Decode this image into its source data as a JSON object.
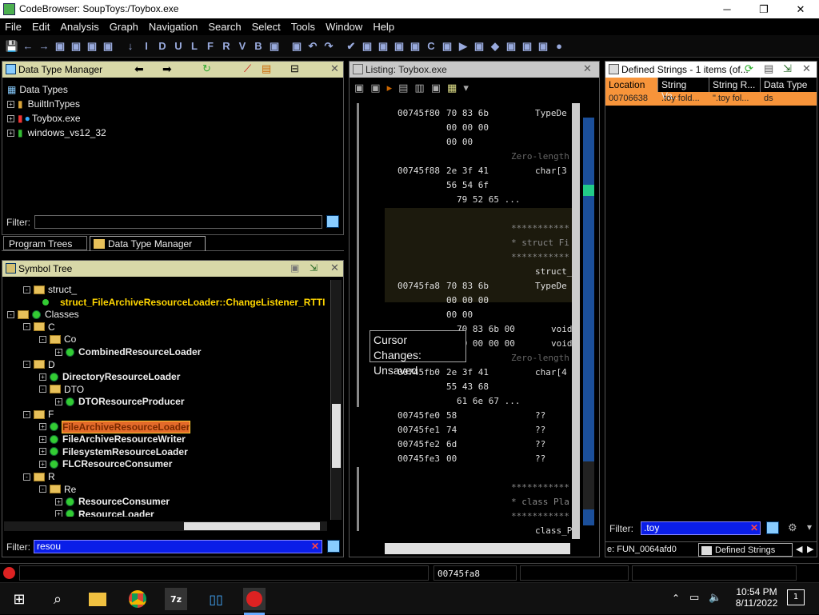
{
  "window": {
    "title": "CodeBrowser: SoupToys:/Toybox.exe",
    "min": "─",
    "max": "❐",
    "close": "✕"
  },
  "menu": [
    "File",
    "Edit",
    "Analysis",
    "Graph",
    "Navigation",
    "Search",
    "Select",
    "Tools",
    "Window",
    "Help"
  ],
  "toolbar_glyphs": [
    "💾",
    "←",
    "→",
    "▣",
    "▣",
    "▣",
    "▣",
    "↓",
    "I",
    "D",
    "U",
    "L",
    "F",
    "R",
    "V",
    "B",
    "▣",
    "▣",
    "↶",
    "↷",
    "✔",
    "▣",
    "▣",
    "▣",
    "▣",
    "C",
    "▣",
    "▶",
    "▣",
    "◆",
    "▣",
    "▣",
    "▣",
    "●"
  ],
  "dtm": {
    "title": "Data Type Manager",
    "root": "Data Types",
    "items": [
      "BuiltInTypes",
      "Toybox.exe",
      "windows_vs12_32"
    ],
    "filter_label": "Filter:",
    "filter_value": ""
  },
  "tabs": {
    "program_trees": "Program Trees",
    "dtm": "Data Type Manager"
  },
  "symtree": {
    "title": "Symbol Tree",
    "rows": [
      {
        "text": "struct_",
        "kind": "folder",
        "indent": 1
      },
      {
        "text": "struct_FileArchiveResourceLoader::ChangeListener_RTTI",
        "kind": "leaf",
        "indent": 2
      },
      {
        "text": "Classes",
        "kind": "classes",
        "indent": 0
      },
      {
        "text": "C",
        "kind": "folder",
        "indent": 1
      },
      {
        "text": "Co",
        "kind": "folder",
        "indent": 2
      },
      {
        "text": "CombinedResourceLoader",
        "kind": "class",
        "indent": 3
      },
      {
        "text": "D",
        "kind": "folder",
        "indent": 1
      },
      {
        "text": "DirectoryResourceLoader",
        "kind": "class",
        "indent": 2
      },
      {
        "text": "DTO",
        "kind": "folder",
        "indent": 2
      },
      {
        "text": "DTOResourceProducer",
        "kind": "class",
        "indent": 3
      },
      {
        "text": "F",
        "kind": "folder",
        "indent": 1
      },
      {
        "text": "FileArchiveResourceLoader",
        "kind": "selected",
        "indent": 2
      },
      {
        "text": "FileArchiveResourceWriter",
        "kind": "class",
        "indent": 2
      },
      {
        "text": "FilesystemResourceLoader",
        "kind": "class",
        "indent": 2
      },
      {
        "text": "FLCResourceConsumer",
        "kind": "class",
        "indent": 2
      },
      {
        "text": "R",
        "kind": "folder",
        "indent": 1
      },
      {
        "text": "Re",
        "kind": "folder",
        "indent": 2
      },
      {
        "text": "ResourceConsumer",
        "kind": "class",
        "indent": 3
      },
      {
        "text": "ResourceLoader",
        "kind": "class",
        "indent": 3
      },
      {
        "text": "ResourceLoaderException",
        "kind": "class",
        "indent": 3
      }
    ],
    "filter_label": "Filter:",
    "filter_value": "resou"
  },
  "listing": {
    "title": "Listing:  Toybox.exe",
    "lines": [
      {
        "a": "00745f80",
        "h": "70 83 6b",
        "m": "TypeDe"
      },
      {
        "a": "",
        "h": "00 00 00",
        "m": ""
      },
      {
        "a": "",
        "h": "00 00",
        "m": ""
      },
      {
        "a": "",
        "h": "",
        "m": "",
        "c": "Zero-length"
      },
      {
        "a": "00745f88",
        "h": "2e 3f 41",
        "m": "char[3"
      },
      {
        "a": "",
        "h": "56 54 6f",
        "m": ""
      },
      {
        "a": "",
        "h": "79 52 65 ...",
        "m": ""
      },
      {
        "a": "",
        "h": "",
        "m": ""
      },
      {
        "a": "",
        "h": "",
        "m": "",
        "s": "***********"
      },
      {
        "a": "",
        "h": "",
        "m": "",
        "s": "* struct Fi"
      },
      {
        "a": "",
        "h": "",
        "m": "",
        "s": "***********"
      },
      {
        "a": "",
        "h": "",
        "m": "struct_File"
      },
      {
        "a": "00745fa8",
        "h": "70 83 6b",
        "m": "TypeDe"
      },
      {
        "a": "",
        "h": "00 00 00",
        "m": ""
      },
      {
        "a": "",
        "h": "00 00",
        "m": ""
      },
      {
        "a": "",
        "h": "70 83 6b 00",
        "m": "void"
      },
      {
        "a": "",
        "h": "00 00 00 00",
        "m": "void"
      },
      {
        "a": "",
        "h": "",
        "m": "",
        "c": "Zero-length"
      },
      {
        "a": "00745fb0",
        "h": "2e 3f 41",
        "m": "char[4"
      },
      {
        "a": "",
        "h": "55 43 68",
        "m": ""
      },
      {
        "a": "",
        "h": "61 6e 67 ...",
        "m": ""
      },
      {
        "a": "00745fe0",
        "h": "58",
        "m": "??"
      },
      {
        "a": "00745fe1",
        "h": "74",
        "m": "??"
      },
      {
        "a": "00745fe2",
        "h": "6d",
        "m": "??"
      },
      {
        "a": "00745fe3",
        "h": "00",
        "m": "??"
      },
      {
        "a": "",
        "h": "",
        "m": ""
      },
      {
        "a": "",
        "h": "",
        "m": "",
        "s": "***********"
      },
      {
        "a": "",
        "h": "",
        "m": "",
        "s": "* class Pla"
      },
      {
        "a": "",
        "h": "",
        "m": "",
        "s": "***********"
      },
      {
        "a": "",
        "h": "",
        "m": "class_Playe"
      }
    ]
  },
  "tooltip": {
    "line1": "Cursor",
    "line2": "Changes: Unsaved"
  },
  "strings": {
    "title": "Defined Strings - 1 items (of...",
    "columns": [
      "Location",
      "String Va...",
      "String R...",
      "Data Type"
    ],
    "row": [
      "00706638",
      ".toy fold...",
      "\".toy fol...",
      "ds"
    ],
    "filter_label": "Filter:",
    "filter_value": ".toy",
    "bottom_left": "e: FUN_0064afd0",
    "bottom_tab": "Defined Strings"
  },
  "status": {
    "address": "00745fa8"
  },
  "taskbar": {
    "time": "10:54 PM",
    "date": "8/11/2022",
    "notif": "1"
  },
  "colors": {
    "panel_head": "#d8d8a8",
    "selected": "#e46a2a",
    "filter_blue": "#0a1ee8",
    "accent_orange": "#f7943a"
  }
}
